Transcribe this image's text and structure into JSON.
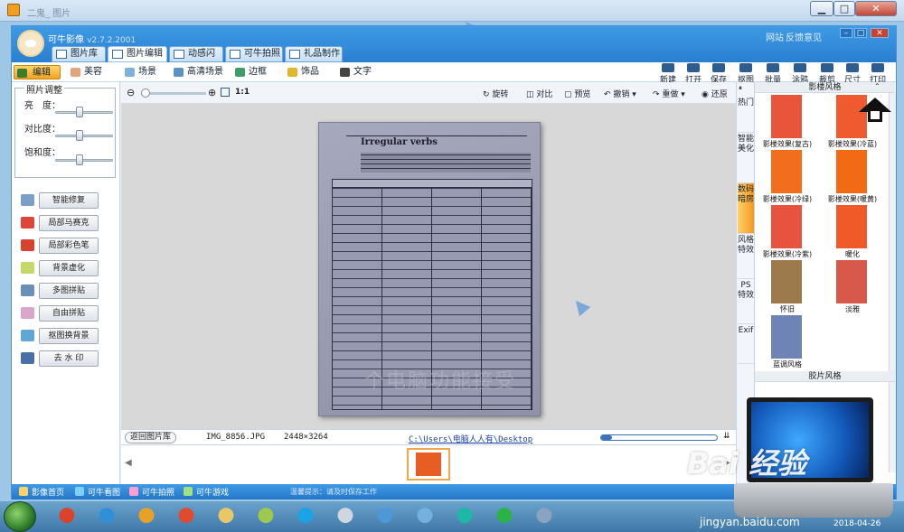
{
  "os_window": {
    "title": "二鬼_ 图片"
  },
  "app": {
    "name": "可牛影像",
    "version": "v2.7.2.2001",
    "top_links": [
      "网站",
      "反馈意见"
    ],
    "tabs": [
      "图片库",
      "图片编辑",
      "动感闪图",
      "可牛拍照",
      "礼品制作"
    ],
    "active_tab": "图片编辑"
  },
  "subtabs": [
    "编辑",
    "美容",
    "场景",
    "高清场景",
    "边框",
    "饰品",
    "文字"
  ],
  "active_subtab": "编辑",
  "toolbar_right": [
    "新建",
    "打开",
    "保存",
    "抠图",
    "批量",
    "涂鸦",
    "裁剪",
    "尺寸",
    "打印"
  ],
  "left_panel": {
    "adjust_title": "照片调整",
    "sliders": [
      {
        "label": "亮　度：",
        "value": 0.45
      },
      {
        "label": "对比度：",
        "value": 0.45
      },
      {
        "label": "饱和度：",
        "value": 0.45
      }
    ],
    "functions": [
      "智能修复",
      "局部马赛克",
      "局部彩色笔",
      "背景虚化",
      "多图拼贴",
      "自由拼贴",
      "抠图换背景",
      "去 水 印"
    ]
  },
  "canvas_toolbar": {
    "zoom_ratio": "1:1",
    "buttons": [
      "旋转",
      "对比",
      "预览",
      "撤销",
      "重做",
      "还原"
    ]
  },
  "document": {
    "heading": "Irregular verbs",
    "watermark": "个电脑功能接受"
  },
  "info_bar": {
    "back_button": "返回图片库",
    "filename": "IMG_8856.JPG",
    "dimensions": "2448×3264",
    "path": "C:\\Users\\电脑人人有\\Desktop"
  },
  "right_panel": {
    "vertical_tabs": [
      "热门",
      "智能美化",
      "数码暗房",
      "风格特效",
      "PS特效",
      "Exif"
    ],
    "active_vtab": "数码暗房",
    "section1": "影楼风格",
    "section2": "胶片风格",
    "effects": [
      {
        "label": "影楼效果(复古)",
        "color": "#e8553a"
      },
      {
        "label": "影楼效果(冷蓝)",
        "color": "#ef5a2f"
      },
      {
        "label": "影楼效果(冷绿)",
        "color": "#f06e1c"
      },
      {
        "label": "影楼效果(暖黄)",
        "color": "#f36a15"
      },
      {
        "label": "影楼效果(冷紫)",
        "color": "#e8533f"
      },
      {
        "label": "暖化",
        "color": "#ef5a28"
      },
      {
        "label": "怀旧",
        "color": "#9c7a4c"
      },
      {
        "label": "淡雅",
        "color": "#d8584a"
      },
      {
        "label": "蓝调风格",
        "color": "#6e84b6"
      }
    ]
  },
  "bottom_links": [
    "影像首页",
    "可牛看图",
    "可牛拍照",
    "可牛游戏"
  ],
  "bottom_notice": "温馨提示：请及时保存工作",
  "taskbar": {
    "apps": [
      {
        "name": "start-orb",
        "color": "#3b8a34"
      },
      {
        "name": "app-icon-red",
        "color": "#d9432a"
      },
      {
        "name": "ie-icon",
        "color": "#2f8fd8"
      },
      {
        "name": "media-icon",
        "color": "#e7a126"
      },
      {
        "name": "chrome-icon",
        "color": "#e04a2f"
      },
      {
        "name": "folder-icon",
        "color": "#e8c766"
      },
      {
        "name": "notes-icon",
        "color": "#9fc84f"
      },
      {
        "name": "browser-icon",
        "color": "#1aa3e6"
      },
      {
        "name": "doc-icon",
        "color": "#d0d6e0"
      },
      {
        "name": "remote-icon",
        "color": "#4c98d8"
      },
      {
        "name": "pinwheel-icon",
        "color": "#74b0e0"
      },
      {
        "name": "headset-icon",
        "color": "#1fb7a6"
      },
      {
        "name": "chart-icon",
        "color": "#2bb34a"
      },
      {
        "name": "paint-icon",
        "color": "#8aa4c0"
      },
      {
        "name": "cow-icon",
        "color": "#e05aa8"
      }
    ],
    "clock": "2018-04-26"
  },
  "overlay": {
    "brand": "Bai 经验",
    "url": "jingyan.baidu.com"
  }
}
